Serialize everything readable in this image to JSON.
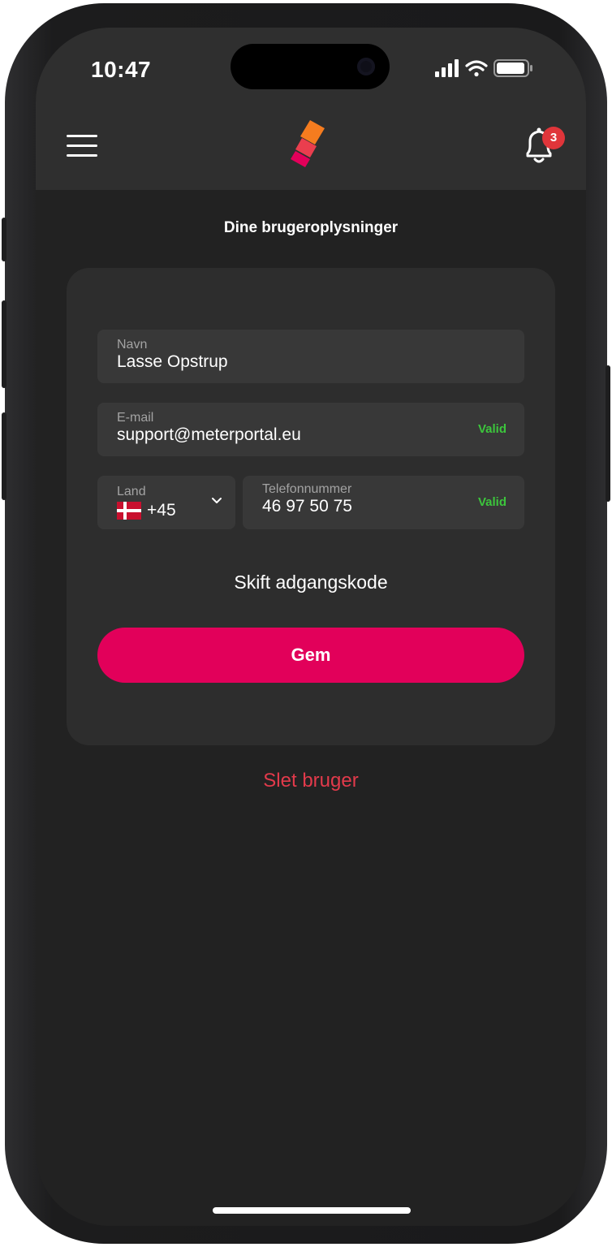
{
  "status_bar": {
    "time": "10:47"
  },
  "header": {
    "menu_icon": "hamburger-menu-icon",
    "logo_icon": "app-logo-icon",
    "notification_icon": "bell-icon",
    "notification_count": "3"
  },
  "page": {
    "title": "Dine brugeroplysninger"
  },
  "form": {
    "name": {
      "label": "Navn",
      "value": "Lasse Opstrup"
    },
    "email": {
      "label": "E-mail",
      "value": "support@meterportal.eu",
      "status": "Valid"
    },
    "country": {
      "label": "Land",
      "value": "+45",
      "flag_icon": "denmark-flag-icon"
    },
    "phone": {
      "label": "Telefonnummer",
      "value": "46 97 50 75",
      "status": "Valid"
    },
    "change_password": "Skift adgangskode",
    "save_label": "Gem"
  },
  "delete_user": "Slet bruger",
  "colors": {
    "accent": "#e2005a",
    "valid": "#3cc63c",
    "danger": "#e23a4b",
    "badge": "#e0353a",
    "background": "#222222",
    "card": "#2d2d2d",
    "field": "#383838"
  }
}
